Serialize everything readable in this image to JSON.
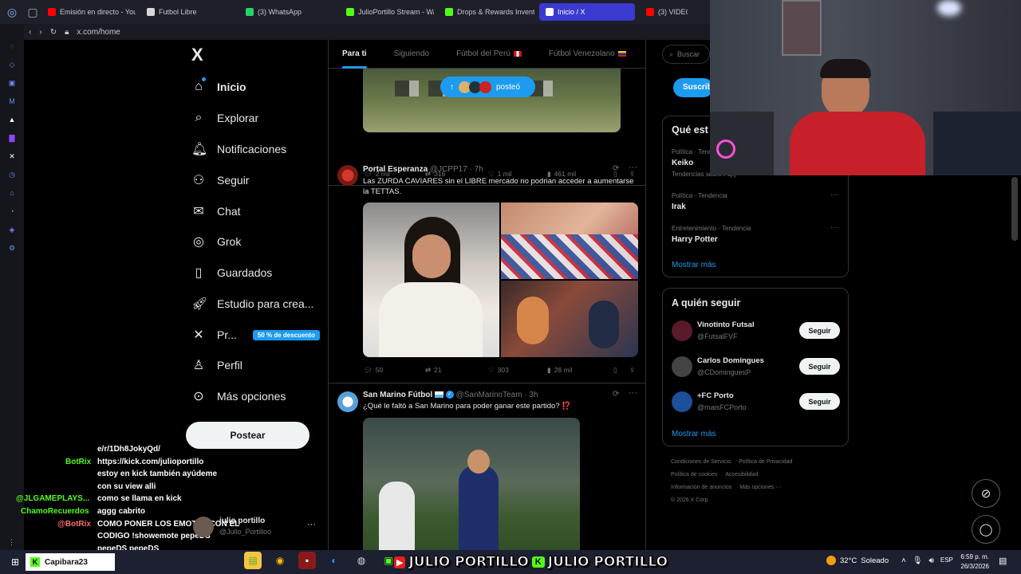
{
  "browser": {
    "tabs": [
      {
        "label": "Emisión en directo - YouTu",
        "color": "#ff0000"
      },
      {
        "label": "Futbol Libre",
        "color": "#d7d7d7"
      },
      {
        "label": "(3) WhatsApp",
        "color": "#25d366"
      },
      {
        "label": "JulioPortillo Stream - Wat",
        "color": "#53fc18"
      },
      {
        "label": "Drops & Rewards Inventor",
        "color": "#53fc18"
      },
      {
        "label": "Inicio / X",
        "color": "#ffffff"
      },
      {
        "label": "(3) VIDEO D",
        "color": "#ff0000"
      }
    ],
    "url": "x.com/home"
  },
  "nav": {
    "logo": "X",
    "items": [
      {
        "label": "Inicio",
        "icon": "home-icon"
      },
      {
        "label": "Explorar",
        "icon": "search-icon"
      },
      {
        "label": "Notificaciones",
        "icon": "bell-icon"
      },
      {
        "label": "Seguir",
        "icon": "add-user-icon"
      },
      {
        "label": "Chat",
        "icon": "mail-icon"
      },
      {
        "label": "Grok",
        "icon": "grok-icon"
      },
      {
        "label": "Guardados",
        "icon": "bookmark-icon"
      },
      {
        "label": "Estudio para crea...",
        "icon": "rocket-icon"
      },
      {
        "label": "Pr...",
        "icon": "x-premium-icon"
      },
      {
        "label": "Perfil",
        "icon": "user-icon"
      },
      {
        "label": "Más opciones",
        "icon": "more-circle-icon"
      }
    ],
    "premium_badge": "50 % de descuento",
    "post_button": "Postear",
    "account_name": "julio portillo",
    "account_handle": "@Julio_Portilloo"
  },
  "feed": {
    "tabs": [
      "Para ti",
      "Siguiendo",
      "Fútbol del Perú",
      "Fútbol Venezolano"
    ],
    "new_posts_pill": "posteó",
    "post0": {
      "replies": "2 mil",
      "reposts": "316",
      "likes": "1 mil",
      "views": "461 mil"
    },
    "post1": {
      "name": "Portal Esperanza",
      "handle": "@JCPP17",
      "time": "· 7h",
      "text": "Las ZURDA CAVIARES sin el LIBRE mercado no podrian acceder a aumentarse la TETTAS.",
      "replies": "50",
      "reposts": "21",
      "likes": "303",
      "views": "28 mil"
    },
    "post2": {
      "name": "San Marino Fútbol",
      "handle": "@SanMarinoTeam",
      "time": "· 3h",
      "text": "¿Qué le faltó a San Marino para poder ganar este partido? ⁉️"
    }
  },
  "right": {
    "search_placeholder": "Buscar",
    "subscribe": "Suscrib",
    "trends_title": "Qué est",
    "trends": [
      {
        "category": "Política · Tende",
        "name": "Keiko",
        "sub": "Tendencias sobre Fujiy"
      },
      {
        "category": "Política · Tendencia",
        "name": "Irak"
      },
      {
        "category": "Entretenimiento · Tendencia",
        "name": "Harry Potter"
      }
    ],
    "trends_more": "Mostrar más",
    "follow_title": "A quién seguir",
    "follow": [
      {
        "name": "Vinotinto Futsal",
        "handle": "@FutsalFVF",
        "button": "Seguir"
      },
      {
        "name": "Carlos Domingues",
        "handle": "@CDominguesP",
        "button": "Seguir"
      },
      {
        "name": "+FC Porto",
        "handle": "@maisFCPorto",
        "button": "Seguir"
      }
    ],
    "follow_more": "Mostrar más",
    "footer": [
      "Condiciones de Servicio",
      "Política de Privacidad",
      "Política de cookies",
      "Accesibilidad",
      "Información de anuncios",
      "Más opciones ···",
      "© 2026 X Corp."
    ]
  },
  "chat": [
    {
      "user": "",
      "msg": "e/r/1Dh8JokyQd/",
      "color": "#ffffff"
    },
    {
      "user": "BotRix",
      "msg": "https://kick.com/julioportillo",
      "color": "#53fc18"
    },
    {
      "user": "",
      "msg": "estoy en kick también ayúdeme",
      "color": "#ffffff"
    },
    {
      "user": "",
      "msg": "con su view alli",
      "color": "#ffffff"
    },
    {
      "user": "@JLGAMEPLAYS...",
      "msg": "como se llama en kick",
      "color": "#53fc18"
    },
    {
      "user": "ChamoRecuerdos",
      "msg": "aggg cabrito",
      "color": "#53fc18"
    },
    {
      "user": "@BotRix",
      "msg": "COMO PONER LOS EMOTES CON EL",
      "color": "#ff6b6b"
    },
    {
      "user": "",
      "msg": "CODIGO !showemote pepeDS",
      "color": "#ffffff"
    },
    {
      "user": "",
      "msg": "pepeDS pepeDS",
      "color": "#ffffff"
    }
  ],
  "overlay": {
    "brand_left": "JULIO PORTILLO",
    "brand_right": "JULIO PORTILLO",
    "task_label": "Capibara23"
  },
  "taskbar": {
    "weather": "32°C",
    "weather_desc": "Soleado",
    "lang": "ESP",
    "time": "6:59 p. m.",
    "date": "26/3/2026"
  }
}
